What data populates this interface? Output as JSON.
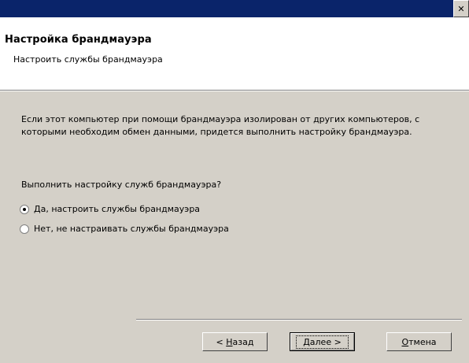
{
  "window": {
    "close_symbol": "✕"
  },
  "header": {
    "title": "Настройка брандмауэра",
    "subtitle": "Настроить службы брандмауэра"
  },
  "content": {
    "description": "Если этот компьютер при помощи брандмауэра изолирован от других компьютеров, с которыми необходим обмен данными, придется выполнить настройку брандмауэра.",
    "question": "Выполнить настройку служб брандмауэра?",
    "options": [
      {
        "label": "Да, настроить службы брандмауэра",
        "selected": true
      },
      {
        "label": "Нет, не настраивать службы брандмауэра",
        "selected": false
      }
    ]
  },
  "buttons": {
    "back": {
      "prefix": "< ",
      "mnemonic": "Н",
      "rest": "азад"
    },
    "next": {
      "mnemonic": "Д",
      "rest": "алее >"
    },
    "cancel": {
      "mnemonic": "О",
      "rest": "тмена"
    }
  }
}
